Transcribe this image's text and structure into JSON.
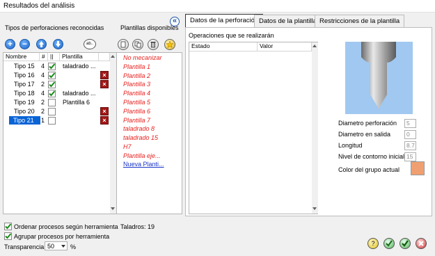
{
  "window": {
    "title": "Resultados del análisis"
  },
  "left": {
    "tipos_label": "Tipos de perforaciones reconocidas",
    "plantillas_label": "Plantillas disponibles",
    "columns": {
      "nombre": "Nombre",
      "num": "#",
      "chk": "||",
      "plantilla": "Plantilla"
    },
    "rows": [
      {
        "name": "Tipo 15",
        "num": "4",
        "checked": true,
        "plantilla": "taladrado ...",
        "x": false
      },
      {
        "name": "Tipo 16",
        "num": "4",
        "checked": true,
        "plantilla": "",
        "x": true
      },
      {
        "name": "Tipo 17",
        "num": "2",
        "checked": true,
        "plantilla": "",
        "x": true
      },
      {
        "name": "Tipo 18",
        "num": "4",
        "checked": true,
        "plantilla": "taladrado ...",
        "x": false
      },
      {
        "name": "Tipo 19",
        "num": "2",
        "checked": false,
        "plantilla": "Plantilla 6",
        "x": false
      },
      {
        "name": "Tipo 20",
        "num": "2",
        "checked": false,
        "plantilla": "",
        "x": true
      },
      {
        "name": "Tipo 21",
        "num": "1",
        "checked": false,
        "plantilla": "",
        "x": true
      }
    ],
    "abc_icon_label": "ab.."
  },
  "plantillas": {
    "items": [
      "No mecanizar",
      "Plantilla 1",
      "Plantilla 2",
      "Plantilla 3",
      "Plantilla 4",
      "Plantilla 5",
      "Plantilla 6",
      "Plantilla 7",
      "taladrado 8",
      "taladrado 15",
      "H7",
      "Plantilla eje..."
    ],
    "new_link": "Nueva Planti..."
  },
  "collapse_btn": "«",
  "tabs": [
    "Datos de la perforación",
    "Datos de la plantilla",
    "Restricciones de la plantilla"
  ],
  "panel": {
    "ops_label": "Operaciones que se realizarán",
    "ops_columns": [
      "Estado",
      "Valor"
    ],
    "fields": [
      {
        "label": "Diametro perforación",
        "value": "5"
      },
      {
        "label": "Diametro en salida",
        "value": "0"
      },
      {
        "label": "Longitud",
        "value": "8.7"
      },
      {
        "label": "Nivel de contorno inicial",
        "value": "15"
      }
    ],
    "color_label": "Color del grupo actual",
    "group_color": "#f0a070"
  },
  "bottom": {
    "ordenar": "Ordenar procesos según herramienta",
    "agrupar": "Agrupar procesos por herramienta",
    "taladros": "Taladros: 19",
    "transparencia": "Transparencia",
    "transp_value": "50",
    "percent": "%"
  },
  "icons": [
    "plus-icon",
    "minus-icon",
    "arrow-up-icon",
    "arrow-down-icon",
    "abc-icon",
    "new-doc-icon",
    "copy-icon",
    "trash-icon",
    "star-icon",
    "help-icon",
    "check-dots-icon",
    "check-icon",
    "close-icon"
  ]
}
